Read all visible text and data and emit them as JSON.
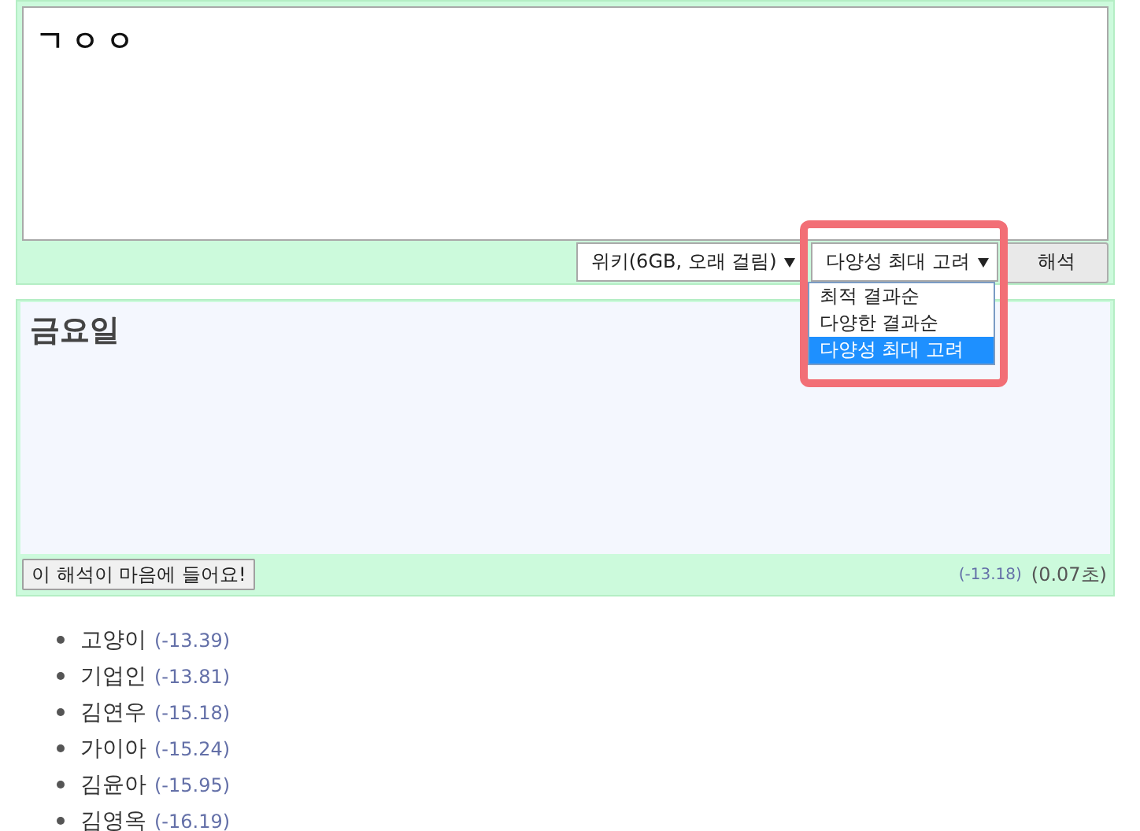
{
  "input": {
    "value": "ㄱㅇㅇ"
  },
  "source_select": {
    "value": "위키(6GB, 오래 걸림)"
  },
  "order_select": {
    "value": "다양성 최대 고려",
    "expanded": true,
    "highlighted": true,
    "options": [
      {
        "label": "최적 결과순",
        "selected": false
      },
      {
        "label": "다양한 결과순",
        "selected": false
      },
      {
        "label": "다양성 최대 고려",
        "selected": true
      }
    ]
  },
  "analyze_button": {
    "label": "해석"
  },
  "result": {
    "text": "금요일",
    "like_button": "이 해석이 마음에 들어요!",
    "score": "(-13.18)",
    "time": "(0.07초)"
  },
  "candidates": [
    {
      "word": "고양이",
      "score": "(-13.39)"
    },
    {
      "word": "기업인",
      "score": "(-13.81)"
    },
    {
      "word": "김연우",
      "score": "(-15.18)"
    },
    {
      "word": "가이아",
      "score": "(-15.24)"
    },
    {
      "word": "김윤아",
      "score": "(-15.95)"
    },
    {
      "word": "김영옥",
      "score": "(-16.19)"
    }
  ]
}
